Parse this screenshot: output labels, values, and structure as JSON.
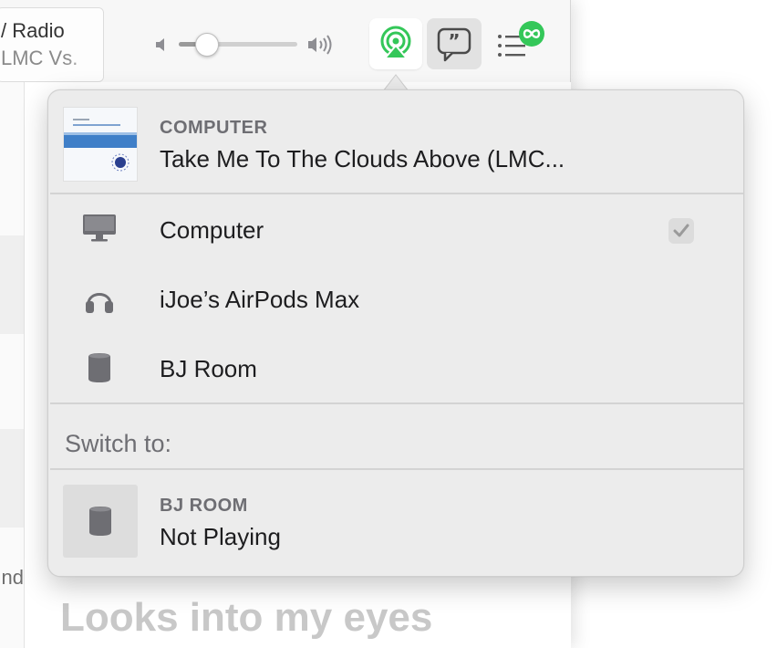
{
  "toolbar": {
    "now_playing_line1": "/ Radio",
    "now_playing_line2": "LMC Vs.",
    "volume_level": 0.24,
    "queue_badge_icon": "infinity-icon"
  },
  "background": {
    "left_text": "nd",
    "heading": "Looks into my eyes"
  },
  "airplay": {
    "current": {
      "label": "COMPUTER",
      "title": "Take Me To The Clouds Above (LMC..."
    },
    "devices": [
      {
        "name": "Computer",
        "icon": "display-icon",
        "selected": true
      },
      {
        "name": "iJoe’s AirPods Max",
        "icon": "headphones-icon",
        "selected": false
      },
      {
        "name": "BJ Room",
        "icon": "homepod-icon",
        "selected": false
      }
    ],
    "switch_to_label": "Switch to:",
    "switch_target": {
      "label": "BJ ROOM",
      "status": "Not Playing"
    }
  },
  "colors": {
    "airplay_green": "#34c759",
    "popover_bg": "#ececec",
    "badge_green": "#34c759"
  }
}
